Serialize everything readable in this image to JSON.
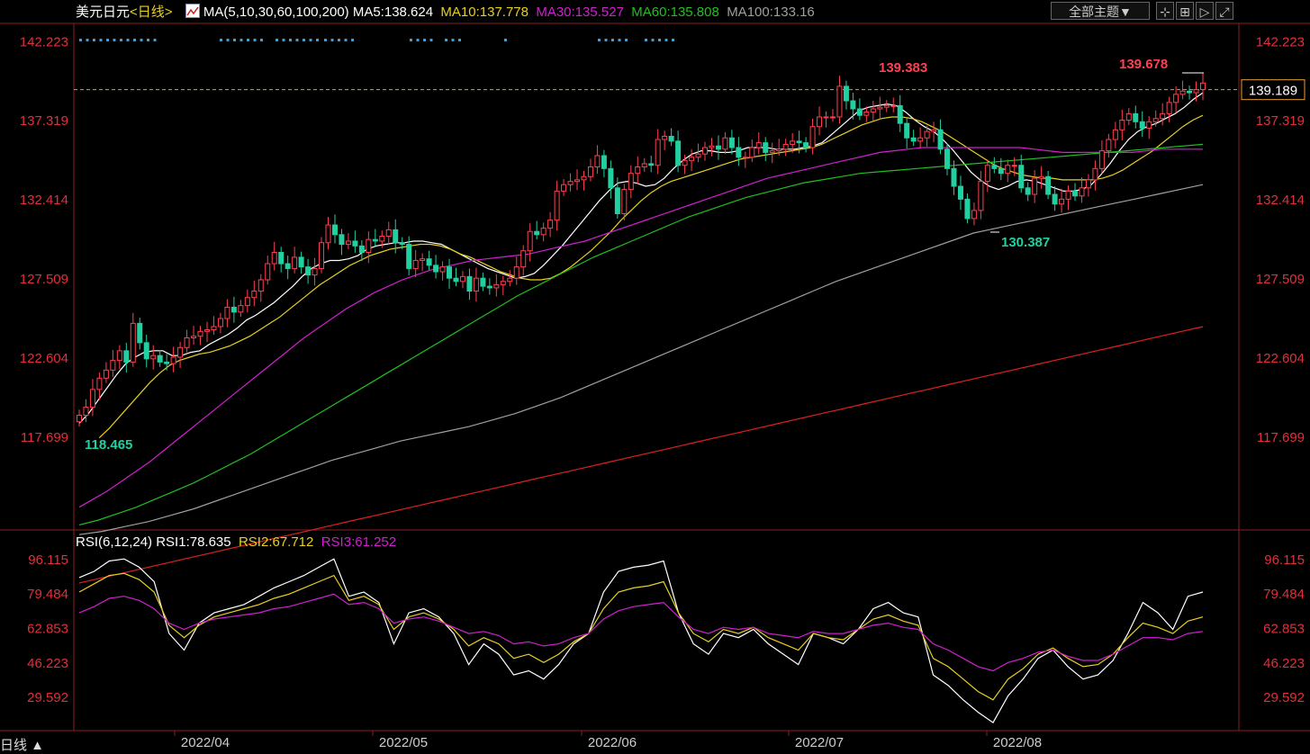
{
  "header": {
    "symbol": "美元日元",
    "period": "<日线>",
    "ma_label": "MA(5,10,30,60,100,200)",
    "ma5": "MA5:138.624",
    "ma10": "MA10:137.778",
    "ma30": "MA30:135.527",
    "ma60": "MA60:135.808",
    "ma100": "MA100:133.16",
    "theme_button": "全部主题▼",
    "colors": {
      "ma5": "#ffffff",
      "ma10": "#e8d020",
      "ma30": "#d020d0",
      "ma60": "#20c020",
      "ma100": "#a0a0a0",
      "ma200": "#e02020",
      "up": "#ff4050",
      "down": "#20d0a0"
    }
  },
  "toolbar_icons": [
    "crosshair-icon",
    "grid-icon",
    "replay-icon",
    "expand-icon"
  ],
  "rsi_header": {
    "label": "RSI(6,12,24)",
    "rsi1": "RSI1:78.635",
    "rsi2": "RSI2:67.712",
    "rsi3": "RSI3:61.252"
  },
  "bottom": {
    "period_label": "日线 ▲"
  },
  "chart_data": [
    {
      "type": "candlestick",
      "y_ticks": [
        "142.223",
        "137.319",
        "132.414",
        "127.509",
        "122.604",
        "117.699"
      ],
      "y_tick_values": [
        142.223,
        137.319,
        132.414,
        127.509,
        122.604,
        117.699
      ],
      "ylim": [
        112.0,
        143.3
      ],
      "current_price": "139.189",
      "current_value": 139.189,
      "annotations": {
        "high": "139.383",
        "recent_high": "139.678",
        "low": "130.387",
        "start_low": "118.465"
      },
      "x_ticks": [
        "2022/04",
        "2022/05",
        "2022/06",
        "2022/07",
        "2022/08"
      ],
      "closes": [
        119.0,
        119.5,
        120.6,
        121.3,
        121.8,
        122.4,
        123.0,
        122.3,
        124.7,
        123.5,
        122.5,
        122.7,
        122.3,
        122.2,
        122.6,
        123.2,
        123.8,
        123.9,
        124.2,
        124.3,
        124.5,
        125.0,
        125.7,
        125.4,
        125.8,
        126.3,
        126.7,
        127.4,
        128.4,
        129.1,
        128.4,
        128.1,
        128.8,
        128.2,
        127.7,
        128.1,
        129.7,
        130.8,
        130.2,
        129.6,
        129.8,
        129.5,
        129.1,
        129.9,
        129.8,
        130.1,
        130.5,
        129.7,
        129.6,
        128.1,
        128.6,
        128.7,
        128.3,
        127.9,
        128.2,
        127.5,
        127.3,
        127.6,
        126.7,
        127.5,
        127.0,
        126.9,
        127.1,
        127.3,
        127.5,
        128.2,
        129.2,
        130.4,
        130.2,
        130.6,
        131.1,
        132.9,
        133.3,
        133.5,
        133.6,
        133.8,
        134.4,
        135.1,
        134.3,
        133.1,
        131.5,
        133.0,
        134.0,
        134.4,
        134.6,
        134.5,
        136.1,
        136.3,
        136.0,
        134.5,
        134.8,
        135.0,
        135.2,
        135.6,
        135.7,
        135.5,
        136.2,
        135.6,
        135.0,
        135.0,
        135.6,
        135.9,
        135.3,
        135.4,
        135.5,
        135.8,
        136.0,
        135.9,
        135.6,
        136.9,
        137.5,
        137.5,
        137.5,
        139.4,
        138.5,
        138.0,
        137.6,
        137.8,
        138.0,
        138.1,
        138.2,
        138.2,
        137.1,
        136.2,
        136.0,
        136.2,
        136.6,
        136.7,
        135.5,
        134.3,
        133.2,
        132.4,
        131.2,
        131.7,
        133.5,
        134.5,
        134.3,
        134.0,
        134.5,
        134.5,
        133.1,
        132.7,
        133.7,
        133.8,
        132.7,
        132.1,
        132.4,
        132.9,
        132.6,
        133.1,
        133.6,
        134.3,
        135.4,
        136.1,
        136.7,
        137.3,
        137.7,
        137.2,
        136.8,
        137.2,
        137.4,
        137.7,
        138.4,
        138.9,
        139.1,
        139.0,
        139.2,
        139.6
      ],
      "series": [
        {
          "name": "MA5",
          "color": "#ffffff",
          "values": [
            118.5,
            119.1,
            119.9,
            120.7,
            121.5,
            122.2,
            122.6,
            122.9,
            123.0,
            123.0,
            122.7,
            122.7,
            122.9,
            123.0,
            123.4,
            123.7,
            124.0,
            124.4,
            124.9,
            125.2,
            125.6,
            126.0,
            126.5,
            127.0,
            127.6,
            128.1,
            128.4,
            128.6,
            128.6,
            128.7,
            128.9,
            129.3,
            129.5,
            129.6,
            129.7,
            129.7,
            129.8,
            129.8,
            129.7,
            129.6,
            129.3,
            129.0,
            128.7,
            128.4,
            128.1,
            127.9,
            127.7,
            127.5,
            127.6,
            127.8,
            128.3,
            128.9,
            129.5,
            130.2,
            130.9,
            131.6,
            132.3,
            132.9,
            133.4,
            133.5,
            133.4,
            133.2,
            133.3,
            133.7,
            134.3,
            134.8,
            135.2,
            135.4,
            135.4,
            135.3,
            135.3,
            135.4,
            135.6,
            135.6,
            135.6,
            135.5,
            135.5,
            135.5,
            135.6,
            135.7,
            135.9,
            136.4,
            136.9,
            137.4,
            137.9,
            138.1,
            138.2,
            138.3,
            138.2,
            137.8,
            137.3,
            136.9,
            136.6,
            136.1,
            135.5,
            134.8,
            134.1,
            133.6,
            133.2,
            133.0,
            133.2,
            133.5,
            133.6,
            133.5,
            133.3,
            133.1,
            132.9,
            132.9,
            133.0,
            133.3,
            133.9,
            134.6,
            135.4,
            136.1,
            136.6,
            136.9,
            137.1,
            137.4,
            137.7,
            138.1,
            138.6,
            139.0
          ],
          "start": 0
        },
        {
          "name": "MA10",
          "color": "#e8d020",
          "values": [
            117.6,
            118.2,
            118.9,
            119.6,
            120.3,
            121.0,
            121.6,
            122.1,
            122.4,
            122.6,
            122.8,
            122.9,
            123.1,
            123.3,
            123.6,
            123.9,
            124.3,
            124.7,
            125.1,
            125.6,
            126.1,
            126.6,
            127.1,
            127.5,
            127.9,
            128.3,
            128.6,
            128.9,
            129.1,
            129.3,
            129.4,
            129.5,
            129.6,
            129.6,
            129.5,
            129.3,
            129.0,
            128.8,
            128.5,
            128.2,
            127.9,
            127.7,
            127.5,
            127.4,
            127.4,
            127.5,
            127.8,
            128.2,
            128.7,
            129.2,
            129.8,
            130.4,
            131.1,
            131.7,
            132.3,
            132.8,
            133.2,
            133.5,
            133.7,
            133.9,
            134.1,
            134.3,
            134.5,
            134.7,
            134.9,
            135.0,
            135.1,
            135.2,
            135.3,
            135.4,
            135.5,
            135.6,
            135.8,
            136.1,
            136.4,
            136.7,
            137.0,
            137.2,
            137.4,
            137.5,
            137.5,
            137.4,
            137.2,
            136.9,
            136.6,
            136.2,
            135.8,
            135.4,
            135.0,
            134.6,
            134.3,
            134.1,
            133.9,
            133.8,
            133.7,
            133.7,
            133.6,
            133.6,
            133.6,
            133.6,
            133.7,
            133.9,
            134.2,
            134.6,
            135.0,
            135.4,
            135.9,
            136.4,
            136.9,
            137.3,
            137.6
          ],
          "start": 2
        },
        {
          "name": "MA30",
          "color": "#d020d0",
          "values": [
            113.3,
            113.8,
            114.3,
            114.9,
            115.5,
            116.1,
            116.8,
            117.5,
            118.2,
            118.9,
            119.6,
            120.3,
            121.0,
            121.7,
            122.4,
            123.1,
            123.8,
            124.4,
            125.0,
            125.6,
            126.1,
            126.6,
            127.0,
            127.4,
            127.7,
            128.0,
            128.2,
            128.4,
            128.6,
            128.7,
            128.8,
            128.9,
            129.0,
            129.2,
            129.4,
            129.6,
            129.8,
            130.1,
            130.4,
            130.7,
            131.0,
            131.3,
            131.6,
            131.9,
            132.2,
            132.5,
            132.8,
            133.1,
            133.4,
            133.7,
            133.9,
            134.1,
            134.3,
            134.5,
            134.7,
            134.9,
            135.1,
            135.3,
            135.4,
            135.5,
            135.6,
            135.6,
            135.6,
            135.6,
            135.6,
            135.6,
            135.6,
            135.6,
            135.5,
            135.4,
            135.3,
            135.3,
            135.3,
            135.3,
            135.3,
            135.3,
            135.4,
            135.5,
            135.5,
            135.5,
            135.5
          ],
          "start": 0,
          "step": 1.5
        },
        {
          "name": "MA60",
          "color": "#20c020",
          "values": [
            112.2,
            112.5,
            112.9,
            113.3,
            113.8,
            114.3,
            114.8,
            115.4,
            116.0,
            116.6,
            117.3,
            118.0,
            118.7,
            119.4,
            120.1,
            120.8,
            121.5,
            122.2,
            122.9,
            123.6,
            124.3,
            125.0,
            125.7,
            126.4,
            127.0,
            127.6,
            128.2,
            128.8,
            129.3,
            129.8,
            130.3,
            130.8,
            131.3,
            131.7,
            132.1,
            132.5,
            132.8,
            133.1,
            133.4,
            133.6,
            133.8,
            134.0,
            134.1,
            134.2,
            134.3,
            134.4,
            134.5,
            134.6,
            134.7,
            134.8,
            134.9,
            135.0,
            135.1,
            135.2,
            135.3,
            135.4,
            135.5,
            135.6,
            135.7,
            135.8
          ],
          "start": 0,
          "step": 2.0
        },
        {
          "name": "MA100",
          "color": "#a0a0a0",
          "values": [
            111.6,
            111.8,
            112.1,
            112.4,
            112.8,
            113.2,
            113.7,
            114.2,
            114.7,
            115.2,
            115.7,
            116.2,
            116.6,
            117.0,
            117.4,
            117.7,
            118.0,
            118.3,
            118.7,
            119.1,
            119.6,
            120.1,
            120.7,
            121.3,
            121.9,
            122.5,
            123.1,
            123.7,
            124.3,
            124.9,
            125.5,
            126.1,
            126.7,
            127.3,
            127.8,
            128.3,
            128.8,
            129.3,
            129.8,
            130.3,
            130.6,
            130.9,
            131.2,
            131.5,
            131.8,
            132.1,
            132.4,
            132.7,
            133.0,
            133.3
          ],
          "start": 0,
          "step": 2.4
        },
        {
          "name": "MA200",
          "color": "#e02020",
          "values": [
            108.6,
            108.9,
            109.2,
            109.5,
            109.8,
            110.1,
            110.4,
            110.7,
            111.0,
            111.3,
            111.6,
            111.9,
            112.2,
            112.5,
            112.8,
            113.1,
            113.4,
            113.7,
            114.0,
            114.3,
            114.6,
            114.9,
            115.2,
            115.5,
            115.8,
            116.1,
            116.4,
            116.7,
            117.0,
            117.3,
            117.6,
            117.9,
            118.2,
            118.5,
            118.8,
            119.1,
            119.4,
            119.7,
            120.0,
            120.3,
            120.6,
            120.9,
            121.2,
            121.5,
            121.8,
            122.1,
            122.4,
            122.7,
            123.0,
            123.3,
            123.6,
            123.9,
            124.2,
            124.5
          ],
          "start": 0,
          "step": 2.2
        }
      ]
    },
    {
      "type": "line",
      "y_ticks": [
        "96.115",
        "79.484",
        "62.853",
        "46.223",
        "29.592"
      ],
      "y_tick_values": [
        96.115,
        79.484,
        62.853,
        46.223,
        29.592
      ],
      "ylim": [
        14,
        100
      ],
      "series": [
        {
          "name": "RSI1",
          "color": "#ffffff",
          "values": [
            87,
            90,
            95,
            96,
            92,
            85,
            60,
            52,
            65,
            70,
            72,
            74,
            78,
            82,
            85,
            88,
            92,
            96,
            78,
            80,
            75,
            55,
            70,
            72,
            68,
            60,
            45,
            55,
            50,
            40,
            42,
            38,
            45,
            55,
            60,
            80,
            90,
            92,
            93,
            95,
            70,
            55,
            50,
            60,
            58,
            62,
            55,
            50,
            45,
            60,
            58,
            55,
            62,
            72,
            75,
            70,
            68,
            40,
            35,
            28,
            22,
            17,
            30,
            38,
            48,
            52,
            44,
            38,
            40,
            47,
            60,
            75,
            70,
            62,
            78,
            80
          ]
        },
        {
          "name": "RSI2",
          "color": "#e8d020",
          "values": [
            80,
            84,
            88,
            89,
            86,
            80,
            64,
            58,
            64,
            68,
            70,
            72,
            74,
            77,
            79,
            82,
            85,
            88,
            76,
            78,
            74,
            62,
            68,
            70,
            67,
            62,
            54,
            58,
            55,
            48,
            50,
            46,
            50,
            56,
            60,
            72,
            80,
            82,
            83,
            85,
            70,
            60,
            56,
            62,
            60,
            63,
            58,
            55,
            52,
            60,
            58,
            57,
            62,
            67,
            69,
            66,
            64,
            48,
            44,
            38,
            32,
            28,
            38,
            43,
            50,
            53,
            48,
            44,
            45,
            50,
            58,
            65,
            63,
            60,
            66,
            68
          ]
        },
        {
          "name": "RSI3",
          "color": "#d020d0",
          "values": [
            70,
            73,
            77,
            78,
            76,
            72,
            65,
            62,
            65,
            67,
            68,
            69,
            70,
            72,
            73,
            75,
            77,
            79,
            74,
            75,
            72,
            65,
            67,
            68,
            66,
            63,
            60,
            61,
            59,
            55,
            56,
            54,
            55,
            58,
            60,
            67,
            71,
            73,
            74,
            75,
            68,
            62,
            60,
            63,
            62,
            63,
            60,
            59,
            58,
            61,
            60,
            60,
            62,
            64,
            65,
            63,
            62,
            55,
            52,
            48,
            44,
            42,
            46,
            48,
            51,
            52,
            49,
            47,
            47,
            50,
            54,
            58,
            58,
            57,
            60,
            61
          ]
        }
      ]
    }
  ]
}
